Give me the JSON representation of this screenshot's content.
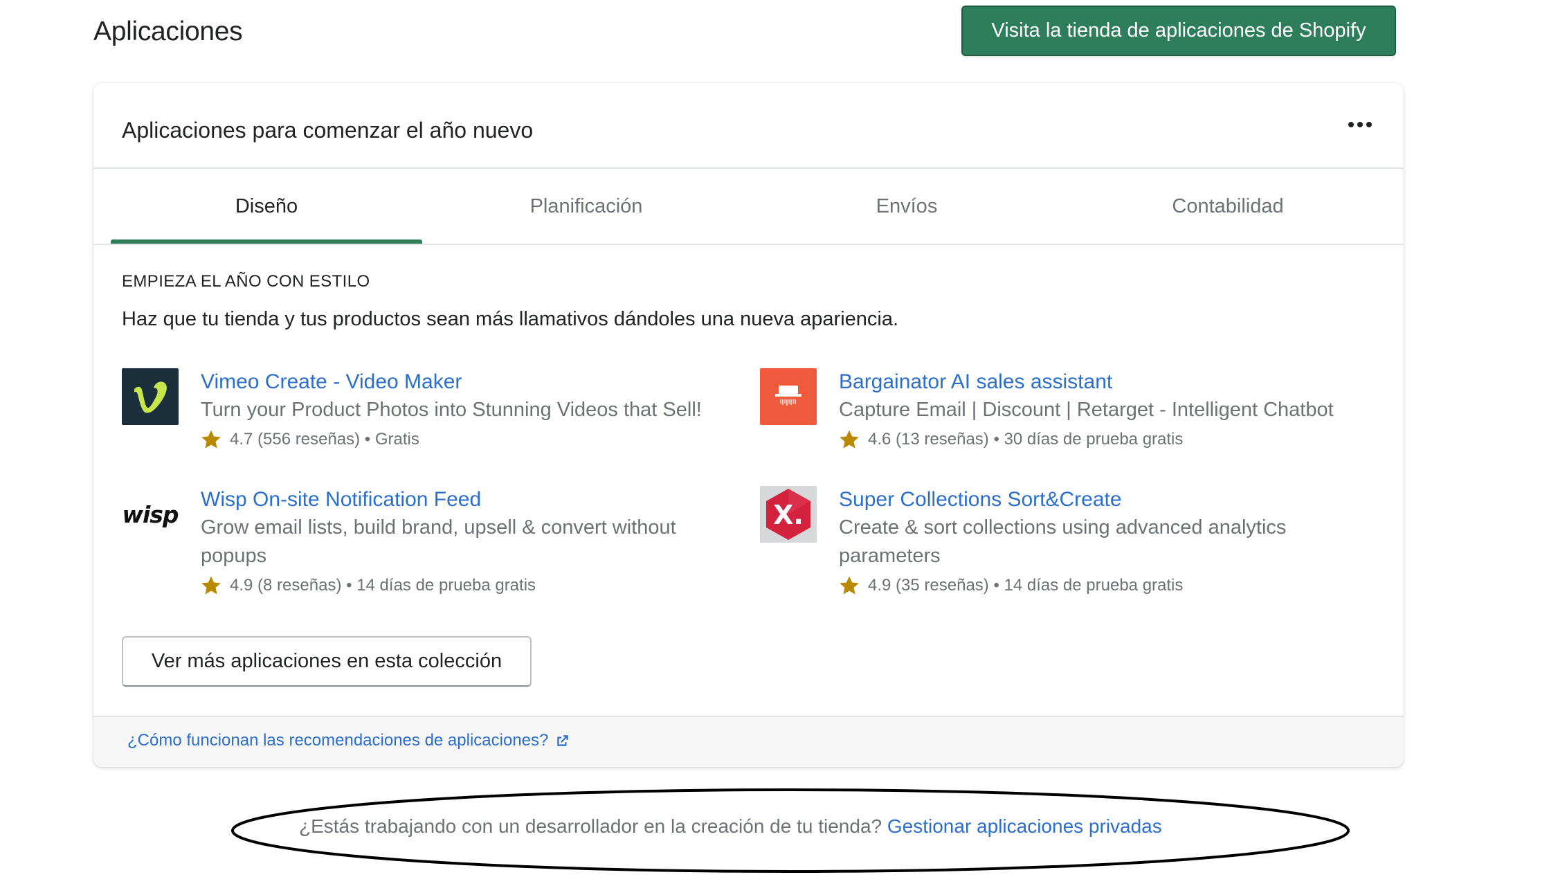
{
  "page": {
    "title": "Aplicaciones",
    "store_button_label": "Visita la tienda de aplicaciones de Shopify"
  },
  "card": {
    "title": "Aplicaciones para comenzar el año nuevo",
    "tabs": [
      {
        "label": "Diseño",
        "active": true
      },
      {
        "label": "Planificación",
        "active": false
      },
      {
        "label": "Envíos",
        "active": false
      },
      {
        "label": "Contabilidad",
        "active": false
      }
    ],
    "section_eyebrow": "EMPIEZA EL AÑO CON ESTILO",
    "section_description": "Haz que tu tienda y tus productos sean más llamativos dándoles una nueva apariencia.",
    "apps": [
      {
        "name": "Vimeo Create - Video Maker",
        "tagline": "Turn your Product Photos into Stunning Videos that Sell!",
        "rating": "4.7",
        "reviews": "(556 reseñas)",
        "separator": "•",
        "pricing": "Gratis",
        "logo_icon": "vimeo-logo-icon"
      },
      {
        "name": "Bargainator AI sales assistant",
        "tagline": "Capture Email | Discount | Retarget - Intelligent Chatbot",
        "rating": "4.6",
        "reviews": "(13 reseñas)",
        "separator": "•",
        "pricing": "30 días de prueba gratis",
        "logo_icon": "bargainator-logo-icon"
      },
      {
        "name": "Wisp On-site Notification Feed",
        "tagline": "Grow email lists, build brand, upsell & convert without popups",
        "rating": "4.9",
        "reviews": "(8 reseñas)",
        "separator": "•",
        "pricing": "14 días de prueba gratis",
        "logo_icon": "wisp-logo-icon",
        "logo_text": "wisp"
      },
      {
        "name": "Super Collections Sort&Create",
        "tagline": "Create & sort collections using advanced analytics parameters",
        "rating": "4.9",
        "reviews": "(35 reseñas)",
        "separator": "•",
        "pricing": "14 días de prueba gratis",
        "logo_icon": "super-collections-logo-icon",
        "logo_text": "X."
      }
    ],
    "more_apps_button_label": "Ver más aplicaciones en esta colección",
    "footer_link_label": "¿Cómo funcionan las recomendaciones de aplicaciones?"
  },
  "developer_note": {
    "text": "¿Estás trabajando con un desarrollador en la creación de tu tienda?",
    "link_label": "Gestionar aplicaciones privadas"
  },
  "colors": {
    "primary_green": "#2e7d5b",
    "link_blue": "#2c6ecb",
    "star_gold": "#b98900",
    "vimeo_bg": "#1a2e3b",
    "vimeo_v": "#c8e64c",
    "bargainator_bg": "#ef5a3c",
    "super_collections_red": "#d4213d"
  }
}
